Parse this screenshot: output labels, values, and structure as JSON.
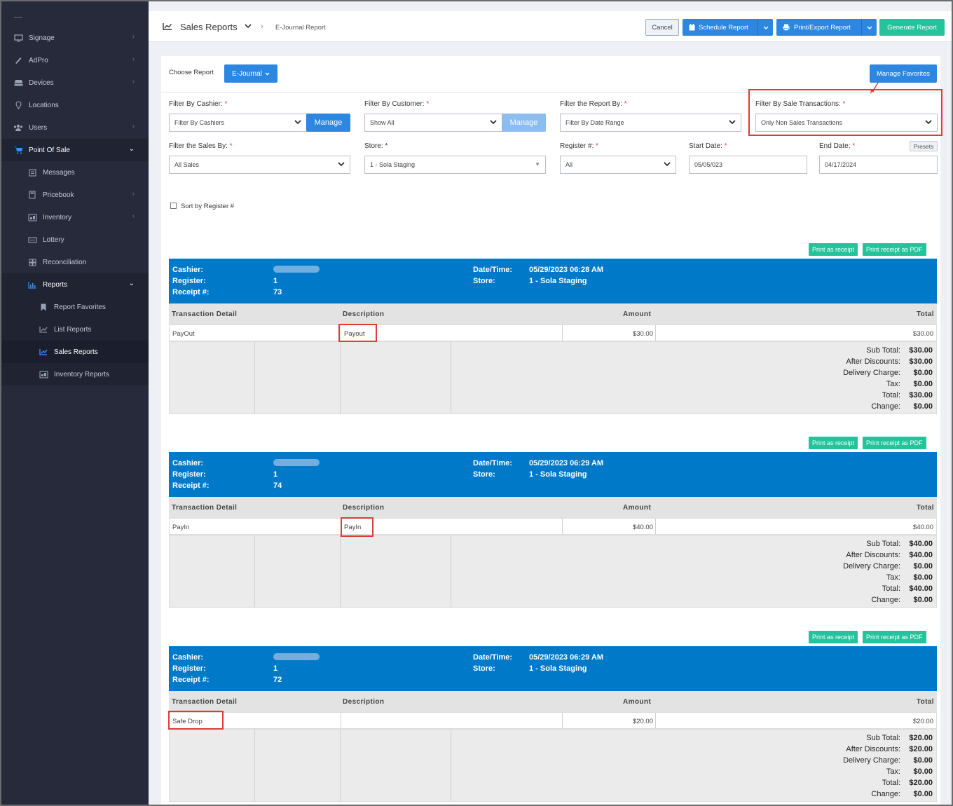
{
  "sidebar": {
    "items": [
      {
        "label": "Signage",
        "icon": "monitor-icon"
      },
      {
        "label": "AdPro",
        "icon": "brush-icon"
      },
      {
        "label": "Devices",
        "icon": "devices-icon"
      },
      {
        "label": "Locations",
        "icon": "location-pin-icon"
      },
      {
        "label": "Users",
        "icon": "users-icon"
      },
      {
        "label": "Point Of Sale",
        "icon": "cart-icon"
      },
      {
        "label": "Messages",
        "icon": "messages-icon"
      },
      {
        "label": "Pricebook",
        "icon": "calculator-icon"
      },
      {
        "label": "Inventory",
        "icon": "inventory-icon"
      },
      {
        "label": "Lottery",
        "icon": "ticket-icon"
      },
      {
        "label": "Reconciliation",
        "icon": "grid-icon"
      },
      {
        "label": "Reports",
        "icon": "bar-chart-icon"
      },
      {
        "label": "Report Favorites",
        "icon": "bookmark-icon"
      },
      {
        "label": "List Reports",
        "icon": "line-chart-icon"
      },
      {
        "label": "Sales Reports",
        "icon": "area-chart-icon"
      },
      {
        "label": "Inventory Reports",
        "icon": "inventory-report-icon"
      }
    ]
  },
  "header": {
    "title": "Sales Reports",
    "crumb": "E-Journal Report",
    "cancel": "Cancel",
    "schedule": "Schedule Report",
    "print_export": "Print/Export Report",
    "generate": "Generate Report"
  },
  "filters": {
    "choose_report_label": "Choose Report",
    "choose_report_value": "E-Journal",
    "manage_favorites": "Manage Favorites",
    "cashier_label": "Filter By Cashier:",
    "cashier_value": "Filter By Cashiers",
    "manage": "Manage",
    "customer_label": "Filter By Customer:",
    "customer_value": "Show All",
    "report_by_label": "Filter the Report By:",
    "report_by_value": "Filter By Date Range",
    "sale_tx_label": "Filter By Sale Transactions:",
    "sale_tx_value": "Only Non Sales Transactions",
    "sales_by_label": "Filter the Sales By:",
    "sales_by_value": "All Sales",
    "store_label": "Store:",
    "store_value": "1 - Sola Staging",
    "register_label": "Register #:",
    "register_value": "All",
    "start_label": "Start Date:",
    "start_value": "05/05/023",
    "end_label": "End Date:",
    "end_value": "04/17/2024",
    "presets": "Presets",
    "sort_label": "Sort by Register #",
    "required_mark": "*"
  },
  "receipt_buttons": {
    "print": "Print as receipt",
    "pdf": "Print receipt as PDF"
  },
  "receipt_labels": {
    "cashier": "Cashier:",
    "register": "Register:",
    "receipt": "Receipt #:",
    "datetime": "Date/Time:",
    "store": "Store:",
    "col_detail": "Transaction Detail",
    "col_desc": "Description",
    "col_amount": "Amount",
    "col_total": "Total",
    "subtotal": "Sub Total:",
    "after_disc": "After Discounts:",
    "delivery": "Delivery Charge:",
    "tax": "Tax:",
    "total": "Total:",
    "change": "Change:"
  },
  "receipts": [
    {
      "register": "1",
      "receipt": "73",
      "datetime": "05/29/2023 06:28 AM",
      "store": "1 - Sola Staging",
      "detail": "PayOut",
      "desc": "Payout",
      "amount": "$30.00",
      "total": "$30.00",
      "subtotal": "$30.00",
      "after_disc": "$30.00",
      "delivery": "$0.00",
      "tax": "$0.00",
      "grand": "$30.00",
      "change": "$0.00"
    },
    {
      "register": "1",
      "receipt": "74",
      "datetime": "05/29/2023 06:29 AM",
      "store": "1 - Sola Staging",
      "detail": "PayIn",
      "desc": "PayIn",
      "amount": "$40.00",
      "total": "$40.00",
      "subtotal": "$40.00",
      "after_disc": "$40.00",
      "delivery": "$0.00",
      "tax": "$0.00",
      "grand": "$40.00",
      "change": "$0.00"
    },
    {
      "register": "1",
      "receipt": "72",
      "datetime": "05/29/2023 06:29 AM",
      "store": "1 - Sola Staging",
      "detail": "Safe Drop",
      "desc": "",
      "amount": "$20.00",
      "total": "$20.00",
      "subtotal": "$20.00",
      "after_disc": "$20.00",
      "delivery": "$0.00",
      "tax": "$0.00",
      "grand": "$20.00",
      "change": "$0.00"
    }
  ],
  "colors": {
    "accent": "#2d86e0",
    "receipt_header": "#0079c8",
    "teal": "#24c39b",
    "highlight": "#e03a3a",
    "sidebar": "#262a3b"
  }
}
